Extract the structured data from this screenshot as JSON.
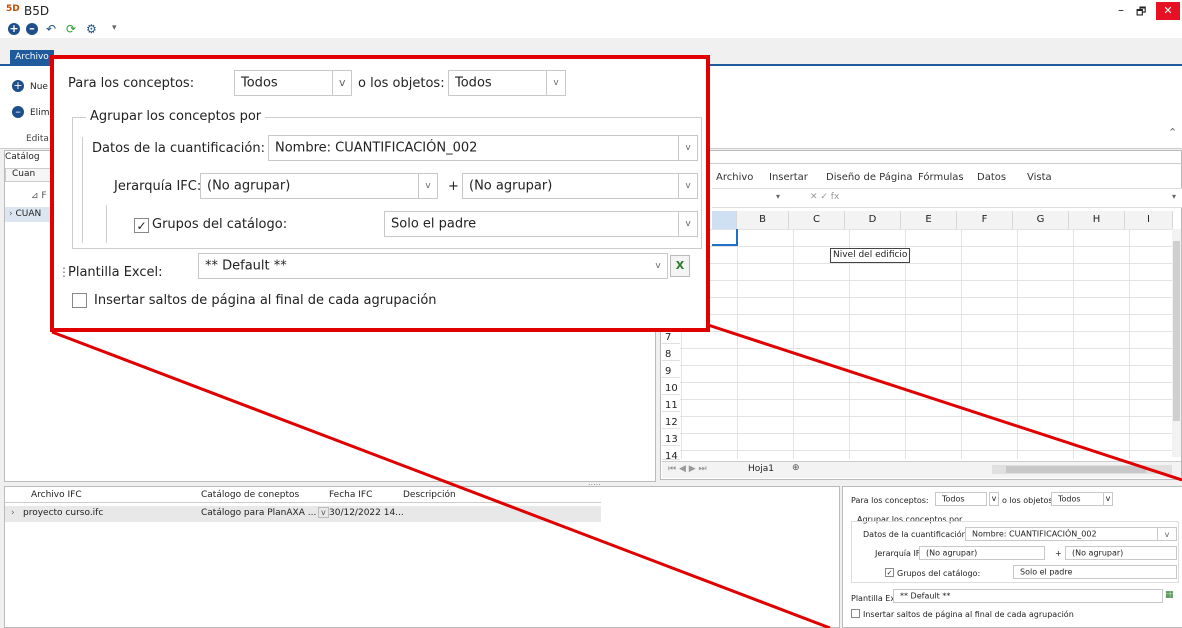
{
  "app": {
    "title": "B5D",
    "logo": "5D"
  },
  "window_controls": {
    "minimize": "–",
    "restore": "🗗",
    "close": "✕"
  },
  "toolbar": {
    "add_icon": "plus-circle",
    "remove_icon": "minus-circle",
    "undo_icon": "undo",
    "refresh_icon": "refresh",
    "settings_icon": "gear",
    "more": "▾"
  },
  "ribbon": {
    "tab_archivo": "Archivo",
    "nuevo": "Nue",
    "eliminar": "Elim",
    "editar": "Edita"
  },
  "left": {
    "tab": "Catálog",
    "col": "Cuan",
    "group_row": "⊿ F",
    "item": "CUAN"
  },
  "sheet": {
    "menu": [
      "Archivo",
      "Insertar",
      "Diseño de Página",
      "Fórmulas",
      "Datos",
      "Vista"
    ],
    "columns": [
      "B",
      "C",
      "D",
      "E",
      "F",
      "G",
      "H",
      "I"
    ],
    "rows": [
      "7",
      "8",
      "9",
      "10",
      "11",
      "12",
      "13",
      "14"
    ],
    "tooltip": "Nivel del edificio",
    "sheet_tab": "Hoja1",
    "formula_glyphs": "✕ ✓ fx"
  },
  "files": {
    "headers": [
      "Archivo IFC",
      "Catálogo de coneptos",
      "Fecha IFC",
      "Descripción"
    ],
    "rows": [
      {
        "archivo": "proyecto curso.ifc",
        "catalogo": "Catálogo para PlanAXA ...",
        "fecha": "30/12/2022 14..."
      }
    ]
  },
  "config": {
    "para_conceptos_label": "Para los conceptos:",
    "para_conceptos_value": "Todos",
    "objetos_label": "o los objetos:",
    "objetos_value": "Todos",
    "agrupar_title": "Agrupar los conceptos por",
    "datos_label": "Datos de la cuantificación:",
    "datos_value": "Nombre: CUANTIFICACIÓN_002",
    "jerarquia_label": "Jerarquía IFC:",
    "jerarquia_value": "(No agrupar)",
    "plus": "+",
    "jerarquia_value2": "(No agrupar)",
    "grupos_label": "Grupos del catálogo:",
    "grupos_value": "Solo el padre",
    "plantilla_label": "Plantilla Excel:",
    "plantilla_value": "** Default **",
    "saltos_label": "Insertar saltos de página al final de cada agrupación"
  },
  "colors": {
    "highlight": "#e00000",
    "ribbon": "#1e5a9c"
  }
}
